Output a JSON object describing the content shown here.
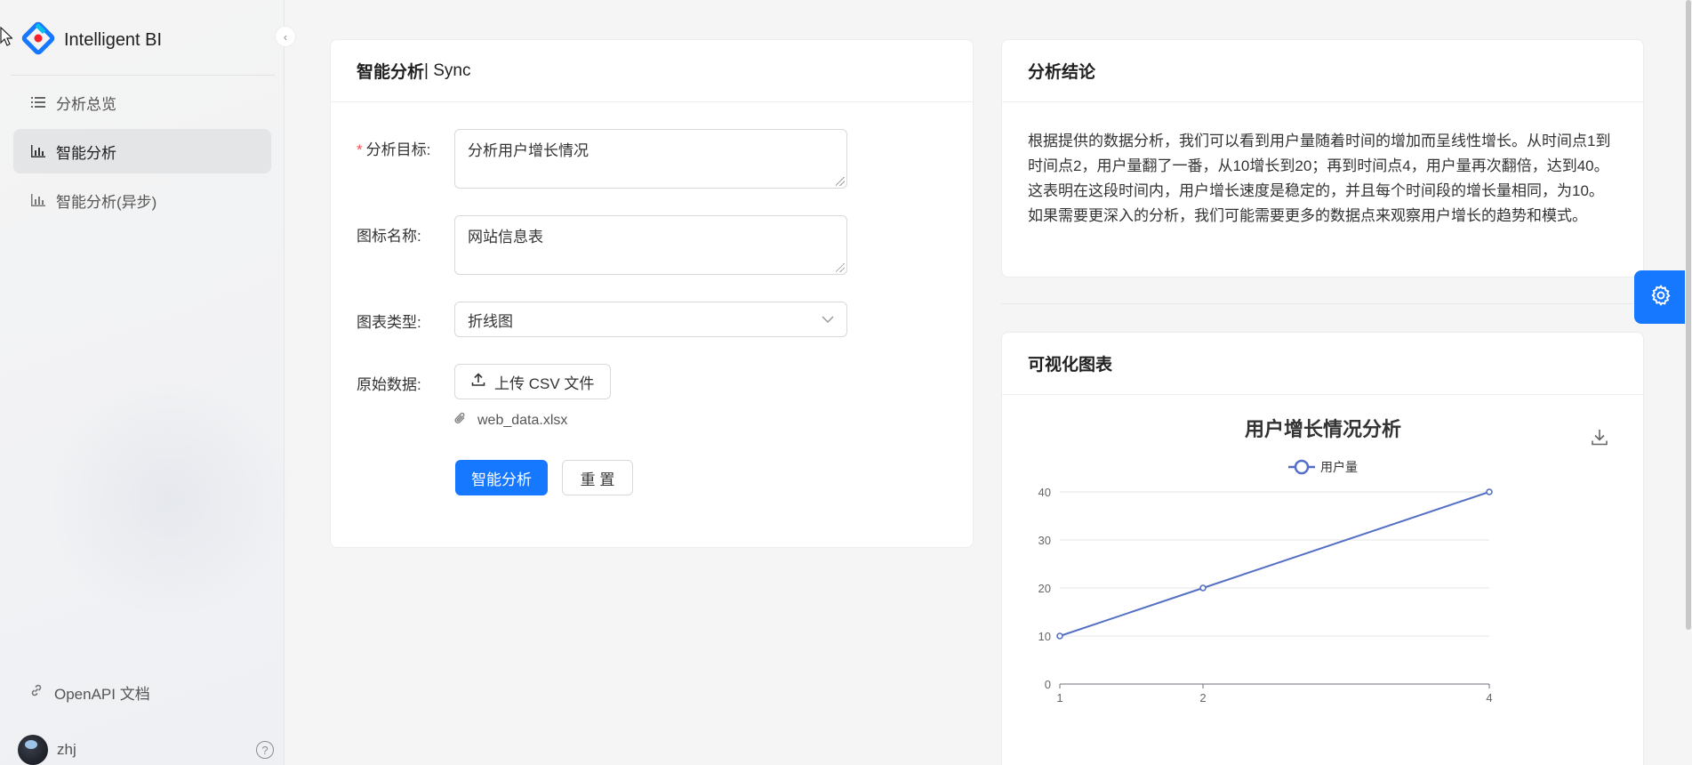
{
  "app": {
    "brand_name": "Intelligent BI"
  },
  "sidebar": {
    "items": [
      {
        "label": "分析总览",
        "icon": "list-icon"
      },
      {
        "label": "智能分析",
        "icon": "bar-chart-icon",
        "active": true
      },
      {
        "label": "智能分析(异步)",
        "icon": "bar-chart-icon"
      }
    ],
    "footer_link": "OpenAPI 文档",
    "username": "zhj",
    "help_glyph": "?"
  },
  "form": {
    "title_bold": "智能分析",
    "title_suffix": " | Sync",
    "goal_label": "分析目标:",
    "goal_required": "*",
    "goal_value": "分析用户增长情况",
    "name_label": "图标名称:",
    "name_value": "网站信息表",
    "type_label": "图表类型:",
    "type_value": "折线图",
    "data_label": "原始数据:",
    "upload_label": "上传 CSV 文件",
    "file_name": "web_data.xlsx",
    "submit_label": "智能分析",
    "reset_label": "重 置"
  },
  "conclusion": {
    "title": "分析结论",
    "text": "根据提供的数据分析，我们可以看到用户量随着时间的增加而呈线性增长。从时间点1到时间点2，用户量翻了一番，从10增长到20；再到时间点4，用户量再次翻倍，达到40。这表明在这段时间内，用户增长速度是稳定的，并且每个时间段的增长量相同，为10。如果需要更深入的分析，我们可能需要更多的数据点来观察用户增长的趋势和模式。"
  },
  "chart_card": {
    "title": "可视化图表"
  },
  "chart_data": {
    "type": "line",
    "title": "用户增长情况分析",
    "categories": [
      "1",
      "2",
      "4"
    ],
    "series": [
      {
        "name": "用户量",
        "values": [
          10,
          20,
          40
        ]
      }
    ],
    "y_ticks": [
      0,
      10,
      20,
      30,
      40
    ],
    "ylim": [
      0,
      40
    ],
    "grid": true,
    "legend": "top-center",
    "color": "#5470c6"
  },
  "colors": {
    "primary": "#1677ff",
    "required": "#ff4d4f",
    "series": "#5470c6"
  }
}
